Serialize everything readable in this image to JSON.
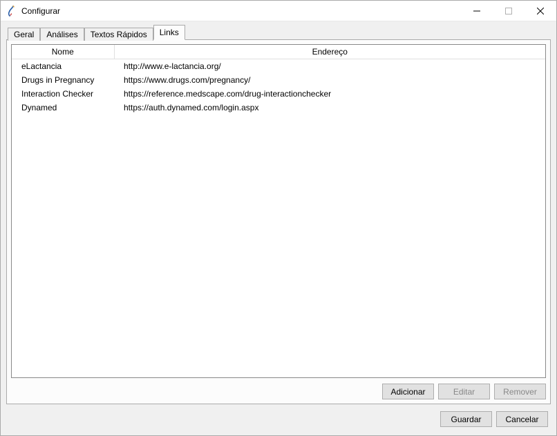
{
  "window": {
    "title": "Configurar"
  },
  "tabs": [
    {
      "label": "Geral",
      "active": false
    },
    {
      "label": "Análises",
      "active": false
    },
    {
      "label": "Textos Rápidos",
      "active": false
    },
    {
      "label": "Links",
      "active": true
    }
  ],
  "table": {
    "columns": {
      "name": "Nome",
      "address": "Endereço"
    },
    "rows": [
      {
        "name": "eLactancia",
        "address": "http://www.e-lactancia.org/"
      },
      {
        "name": "Drugs in Pregnancy",
        "address": "https://www.drugs.com/pregnancy/"
      },
      {
        "name": "Interaction Checker",
        "address": "https://reference.medscape.com/drug-interactionchecker"
      },
      {
        "name": "Dynamed",
        "address": "https://auth.dynamed.com/login.aspx"
      }
    ]
  },
  "buttons_inner": {
    "add": "Adicionar",
    "edit": "Editar",
    "remove": "Remover"
  },
  "buttons_dialog": {
    "save": "Guardar",
    "cancel": "Cancelar"
  }
}
